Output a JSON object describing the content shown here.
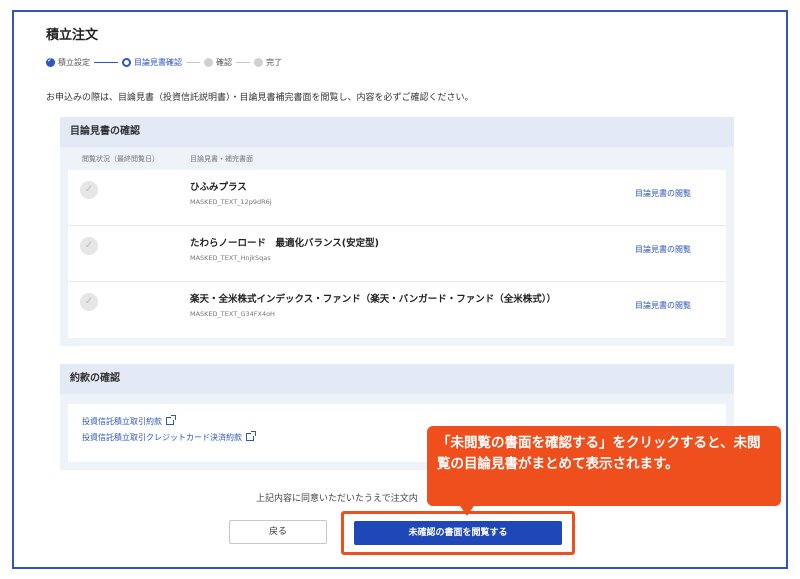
{
  "page": {
    "title": "積立注文"
  },
  "stepper": {
    "steps": [
      {
        "label": "積立設定",
        "state": "done"
      },
      {
        "label": "目論見書確認",
        "state": "current"
      },
      {
        "label": "確認",
        "state": "todo"
      },
      {
        "label": "完了",
        "state": "todo"
      }
    ]
  },
  "intro": "お申込みの際は、目論見書（投資信託説明書）・目論見書補完書面を閲覧し、内容を必ずご確認ください。",
  "prospectus": {
    "title": "目論見書の確認",
    "col_status": "閲覧状況（最終閲覧日）",
    "col_doc": "目論見書・補完書面",
    "rows": [
      {
        "name": "ひふみプラス",
        "code": "MASKED_TEXT_12p9dR6j",
        "link": "目論見書の閲覧"
      },
      {
        "name": "たわらノーロード　最適化バランス(安定型)",
        "code": "MASKED_TEXT_HnjkSqas",
        "link": "目論見書の閲覧"
      },
      {
        "name": "楽天・全米株式インデックス・ファンド（楽天・バンガード・ファンド（全米株式））",
        "code": "MASKED_TEXT_G34FX4oH",
        "link": "目論見書の閲覧"
      }
    ]
  },
  "terms": {
    "title": "約款の確認",
    "links": [
      "投資信託積立取引約款",
      "投資信託積立取引クレジットカード決済約款"
    ]
  },
  "agree_text": "上記内容に同意いただいたうえで注文内",
  "buttons": {
    "back": "戻る",
    "primary": "未確認の書面を閲覧する"
  },
  "callout": {
    "text": "「未閲覧の書面を確認する」をクリックすると、未閲覧の目論見書がまとめて表示されます。"
  },
  "colors": {
    "accent_blue": "#1f47b8",
    "callout_orange": "#ee4f1c",
    "frame_blue": "#2f56b8"
  }
}
